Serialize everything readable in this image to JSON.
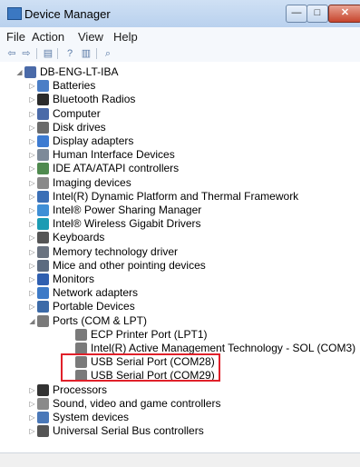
{
  "window": {
    "title": "Device Manager",
    "icon": "device-manager-icon",
    "buttons": {
      "minimize": "—",
      "maximize": "□",
      "close": "✕"
    }
  },
  "menu": [
    "File",
    "Action",
    "View",
    "Help"
  ],
  "toolbar": [
    "back-arrow-icon",
    "forward-arrow-icon",
    "properties-icon",
    "help-icon",
    "show-hidden-icon",
    "scan-hardware-icon"
  ],
  "tree": {
    "root": "DB-ENG-LT-IBA",
    "categories": [
      {
        "label": "Batteries",
        "icon": "battery-icon"
      },
      {
        "label": "Bluetooth Radios",
        "icon": "bluetooth-icon"
      },
      {
        "label": "Computer",
        "icon": "computer-icon"
      },
      {
        "label": "Disk drives",
        "icon": "disk-drive-icon"
      },
      {
        "label": "Display adapters",
        "icon": "display-adapter-icon"
      },
      {
        "label": "Human Interface Devices",
        "icon": "hid-icon"
      },
      {
        "label": "IDE ATA/ATAPI controllers",
        "icon": "ide-controller-icon"
      },
      {
        "label": "Imaging devices",
        "icon": "camera-icon"
      },
      {
        "label": "Intel(R) Dynamic Platform and Thermal Framework",
        "icon": "chip-icon"
      },
      {
        "label": "Intel® Power Sharing Manager",
        "icon": "power-icon"
      },
      {
        "label": "Intel® Wireless Gigabit Drivers",
        "icon": "wireless-icon"
      },
      {
        "label": "Keyboards",
        "icon": "keyboard-icon"
      },
      {
        "label": "Memory technology driver",
        "icon": "memory-icon"
      },
      {
        "label": "Mice and other pointing devices",
        "icon": "mouse-icon"
      },
      {
        "label": "Monitors",
        "icon": "monitor-icon"
      },
      {
        "label": "Network adapters",
        "icon": "network-icon"
      },
      {
        "label": "Portable Devices",
        "icon": "portable-device-icon"
      },
      {
        "label": "Ports (COM & LPT)",
        "icon": "port-icon",
        "expanded": true,
        "children": [
          "ECP Printer Port (LPT1)",
          "Intel(R) Active Management Technology - SOL (COM3)",
          "USB Serial Port (COM28)",
          "USB Serial Port (COM29)"
        ]
      },
      {
        "label": "Processors",
        "icon": "processor-icon"
      },
      {
        "label": "Sound, video and game controllers",
        "icon": "sound-icon"
      },
      {
        "label": "System devices",
        "icon": "system-device-icon"
      },
      {
        "label": "Universal Serial Bus controllers",
        "icon": "usb-icon"
      }
    ]
  },
  "colors": {
    "highlight_box": "#e0202a",
    "title_bar": "#b9d1ee",
    "close_button": "#c7452d"
  }
}
